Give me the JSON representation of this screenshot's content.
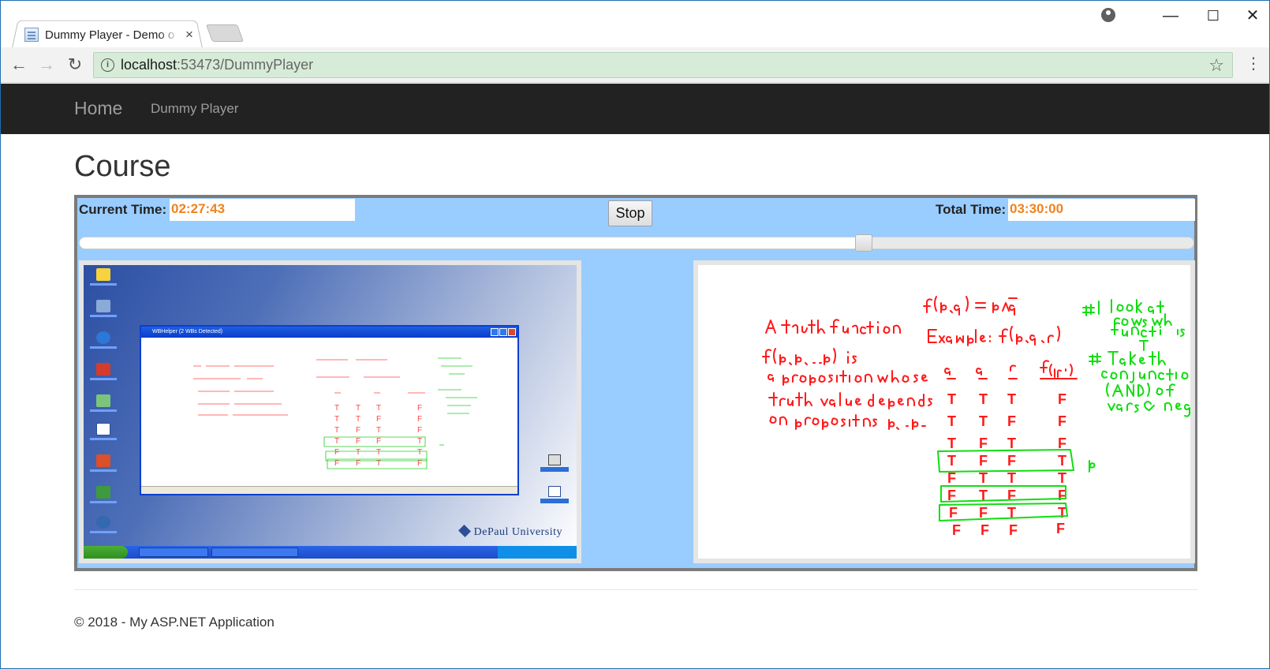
{
  "browser": {
    "tab_title": "Dummy Player - Demo o",
    "tab_close": "×",
    "url_host": "localhost",
    "url_rest": ":53473/DummyPlayer",
    "info_glyph": "i",
    "back_glyph": "←",
    "forward_glyph": "→",
    "reload_glyph": "↻",
    "star_glyph": "☆",
    "menu_glyph": "⋮",
    "minimize_glyph": "—",
    "maximize_glyph": "☐",
    "close_glyph": "✕"
  },
  "navbar": {
    "brand": "Home",
    "links": [
      {
        "label": "Dummy Player"
      }
    ]
  },
  "page": {
    "title": "Course"
  },
  "player": {
    "current_time_label": "Current Time:",
    "current_time": "02:27:43",
    "stop_label": "Stop",
    "total_time_label": "Total Time:",
    "total_time": "03:30:00",
    "progress_fraction": 0.7037,
    "left_video": {
      "window_title": "WBHelper (2 WBs Detected)",
      "university": "DePaul University"
    }
  },
  "footer": {
    "text": "© 2018 - My ASP.NET Application"
  },
  "colors": {
    "navbar_bg": "#222222",
    "player_bg": "#99ccff",
    "player_border": "#7b7b7b",
    "time_text": "#f0821e",
    "omnibox_bg": "#d6ecd8",
    "ink_red": "#ff0000",
    "ink_green": "#00cc00"
  }
}
